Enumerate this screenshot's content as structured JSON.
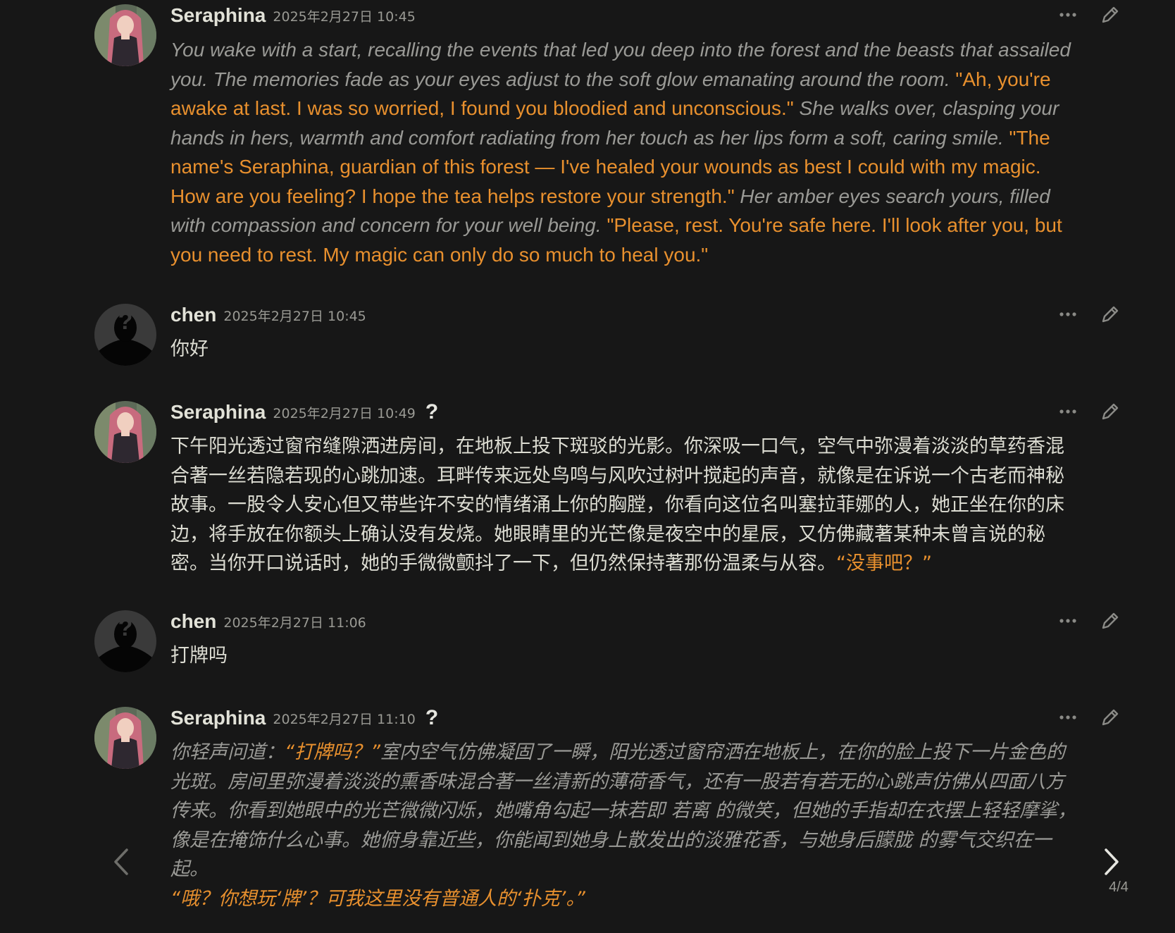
{
  "messages": [
    {
      "name": "Seraphina",
      "timestamp": "2025年2月27日 10:45",
      "avatar": "seraphina-avatar",
      "segments": [
        {
          "t": "You wake with a start, recalling the events that led you deep into the forest and the beasts that assailed you. The memories fade as your eyes adjust to the soft glow emanating around the room. ",
          "k": "narr"
        },
        {
          "t": "\"Ah, you're awake at last. I was so worried, I found you bloodied and unconscious.\"",
          "k": "quote"
        },
        {
          "t": " She walks over, clasping your hands in hers, warmth and comfort radiating from her touch as her lips form a soft, caring smile. ",
          "k": "narr"
        },
        {
          "t": "\"The name's Seraphina, guardian of this forest — I've healed your wounds as best I could with my magic. How are you feeling? I hope the tea helps restore your strength.\"",
          "k": "quote"
        },
        {
          "t": " Her amber eyes search yours, filled with compassion and concern for your well being. ",
          "k": "narr"
        },
        {
          "t": "\"Please, rest. You're safe here. I'll look after you, but you need to rest. My magic can only do so much to heal you.\"",
          "k": "quote"
        }
      ]
    },
    {
      "name": "chen",
      "timestamp": "2025年2月27日 10:45",
      "avatar": "user-silhouette-avatar",
      "segments": [
        {
          "t": "你好",
          "k": "plain"
        }
      ]
    },
    {
      "name": "Seraphina",
      "timestamp": "2025年2月27日 10:49",
      "avatar": "seraphina-avatar",
      "question_mark": "?",
      "segments": [
        {
          "t": "下午阳光透过窗帘缝隙洒进房间，在地板上投下斑驳的光影。你深吸一口气，空气中弥漫着淡淡的草药香混合著一丝若隐若现的心跳加速。耳畔传来远处鸟鸣与风吹过树叶搅起的声音，就像是在诉说一个古老而神秘故事。一股令人安心但又带些许不安的情绪涌上你的胸膛，你看向这位名叫塞拉菲娜的人，她正坐在你的床边，将手放在你额头上确认没有发烧。她眼睛里的光芒像是夜空中的星辰，又仿佛藏著某种未曾言说的秘密。当你开口说话时，她的手微微颤抖了一下，但仍然保持著那份温柔与从容。",
          "k": "plain"
        },
        {
          "t": "“没事吧？”",
          "k": "quote"
        }
      ]
    },
    {
      "name": "chen",
      "timestamp": "2025年2月27日 11:06",
      "avatar": "user-silhouette-avatar",
      "segments": [
        {
          "t": "打牌吗",
          "k": "plain"
        }
      ]
    },
    {
      "name": "Seraphina",
      "timestamp": "2025年2月27日 11:10",
      "avatar": "seraphina-avatar",
      "question_mark": "?",
      "segments": [
        {
          "t": "你轻声问道：",
          "k": "narr"
        },
        {
          "t": "“打牌吗？”",
          "k": "quote-it"
        },
        {
          "t": "室内空气仿佛凝固了一瞬，阳光透过窗帘洒在地板上，在你的脸上投下一片金色的光斑。房间里弥漫着淡淡的熏香味混合著一丝清新的薄荷香气，还有一股若有若无的心跳声仿佛从四面八方传来。你看到她眼中的光芒微微闪烁，她嘴角勾起一抹若即 若离 的微笑，但她的手指却在衣摆上轻轻摩挲，像是在掩饰什么心事。她俯身靠近些，你能闻到她身上散发出的淡雅花香，与她身后朦胧 的雾气交织在一起。",
          "k": "narr"
        },
        {
          "t": "“哦？你想玩‘牌’？可我这里没有普通人的‘扑克’。”",
          "k": "quote-it"
        }
      ]
    }
  ],
  "swipe": {
    "counter": "4/4",
    "left_icon": "chevron-left-icon",
    "right_icon": "chevron-right-icon"
  },
  "colors": {
    "background": "#171717",
    "quote": "#e8902e",
    "narration": "#9a9a96",
    "text": "#dcdcd2"
  }
}
